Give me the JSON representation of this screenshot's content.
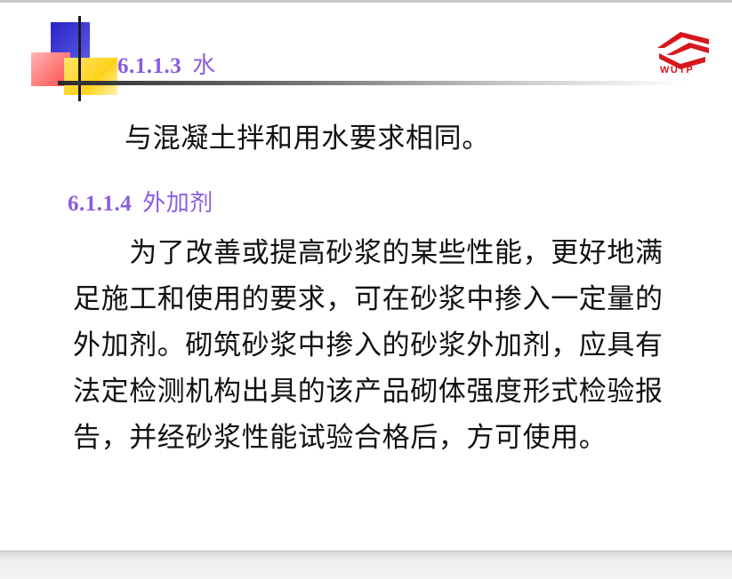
{
  "slide": {
    "section1": {
      "number": "6.1.1.3",
      "title": "水",
      "text": "与混凝土拌和用水要求相同。"
    },
    "section2": {
      "number": "6.1.1.4",
      "title": "外加剂",
      "lines": [
        "　　为了改善或提高砂浆的某些性能，更好地满",
        "足施工和使用的要求，可在砂浆中掺入一定量的",
        "外加剂。砌筑砂浆中掺入的砂浆外加剂，应具有",
        "法定检测机构出具的该产品砌体强度形式检验报",
        "告，并经砂浆性能试验合格后，方可使用。"
      ]
    },
    "logo": {
      "text": "WUTP",
      "color": "#d6171e"
    }
  },
  "colors": {
    "heading": "#8a5ce0",
    "body": "#111111"
  }
}
